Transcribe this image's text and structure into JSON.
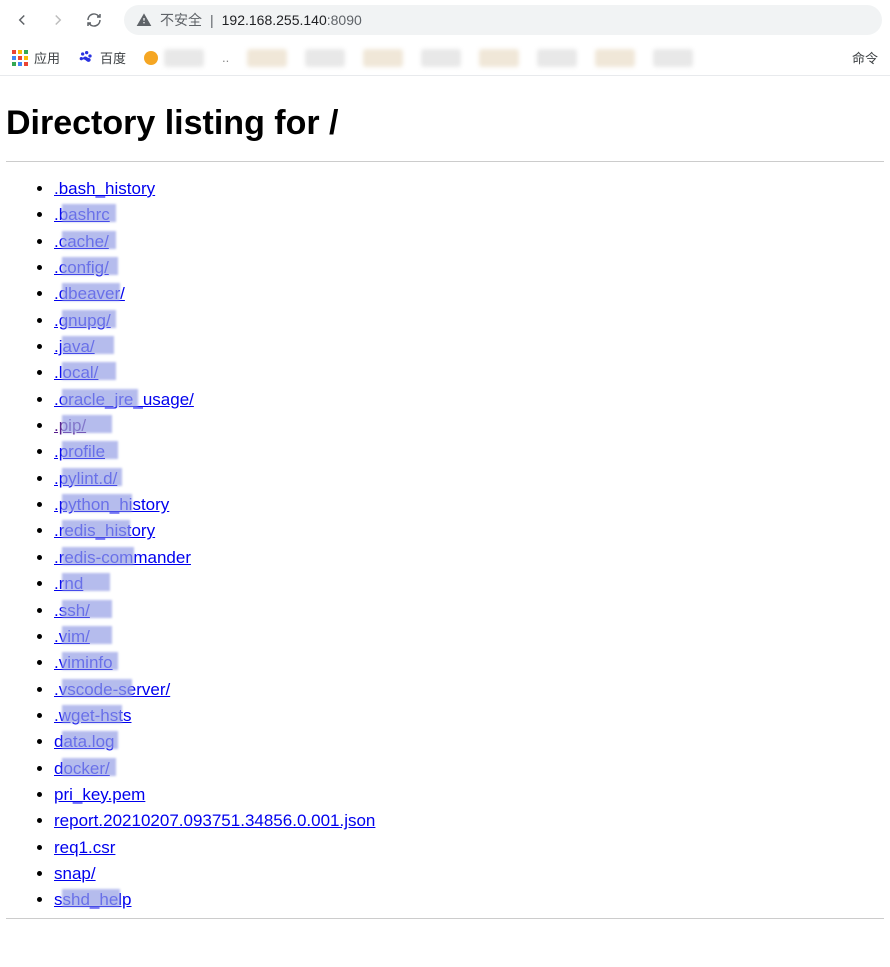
{
  "browser": {
    "insecure_label": "不安全",
    "separator": "|",
    "url_ip": "192.168.255.140",
    "url_port": ":8090"
  },
  "bookmarks": {
    "apps_label": "应用",
    "baidu_label": "百度",
    "right_label": "命令"
  },
  "page": {
    "heading": "Directory listing for /"
  },
  "items": [
    {
      "text": ".bash_history",
      "visited": false
    },
    {
      "text": ".bashrc",
      "visited": false,
      "redacted": true
    },
    {
      "text": ".cache/",
      "visited": false,
      "redacted": true
    },
    {
      "text": ".config/",
      "visited": false,
      "redacted": true
    },
    {
      "text": ".dbeaver/",
      "visited": false,
      "redacted": true
    },
    {
      "text": ".gnupg/",
      "visited": false,
      "redacted": true
    },
    {
      "text": ".java/",
      "visited": false,
      "redacted": true
    },
    {
      "text": ".local/",
      "visited": false,
      "redacted": true
    },
    {
      "text": ".oracle_jre_usage/",
      "visited": false,
      "redacted": true
    },
    {
      "text": ".pip/",
      "visited": true,
      "redacted": true
    },
    {
      "text": ".profile",
      "visited": false,
      "redacted": true
    },
    {
      "text": ".pylint.d/",
      "visited": false,
      "redacted": true
    },
    {
      "text": ".python_history",
      "visited": false,
      "redacted": true
    },
    {
      "text": ".redis_history",
      "visited": false,
      "redacted": true
    },
    {
      "text": ".redis-commander",
      "visited": false,
      "redacted": true
    },
    {
      "text": ".rnd",
      "visited": false,
      "redacted": true
    },
    {
      "text": ".ssh/",
      "visited": false,
      "redacted": true
    },
    {
      "text": ".vim/",
      "visited": false,
      "redacted": true
    },
    {
      "text": ".viminfo",
      "visited": false,
      "redacted": true
    },
    {
      "text": ".vscode-server/",
      "visited": false,
      "redacted": true
    },
    {
      "text": ".wget-hsts",
      "visited": false,
      "redacted": true
    },
    {
      "text": "data.log",
      "visited": false,
      "redacted": true
    },
    {
      "text": "docker/",
      "visited": false,
      "redacted": true
    },
    {
      "text": "pri_key.pem",
      "visited": false
    },
    {
      "text": "report.20210207.093751.34856.0.001.json",
      "visited": false
    },
    {
      "text": "req1.csr",
      "visited": false
    },
    {
      "text": "snap/",
      "visited": false
    },
    {
      "text": "sshd_help",
      "visited": false,
      "redacted": true
    }
  ]
}
